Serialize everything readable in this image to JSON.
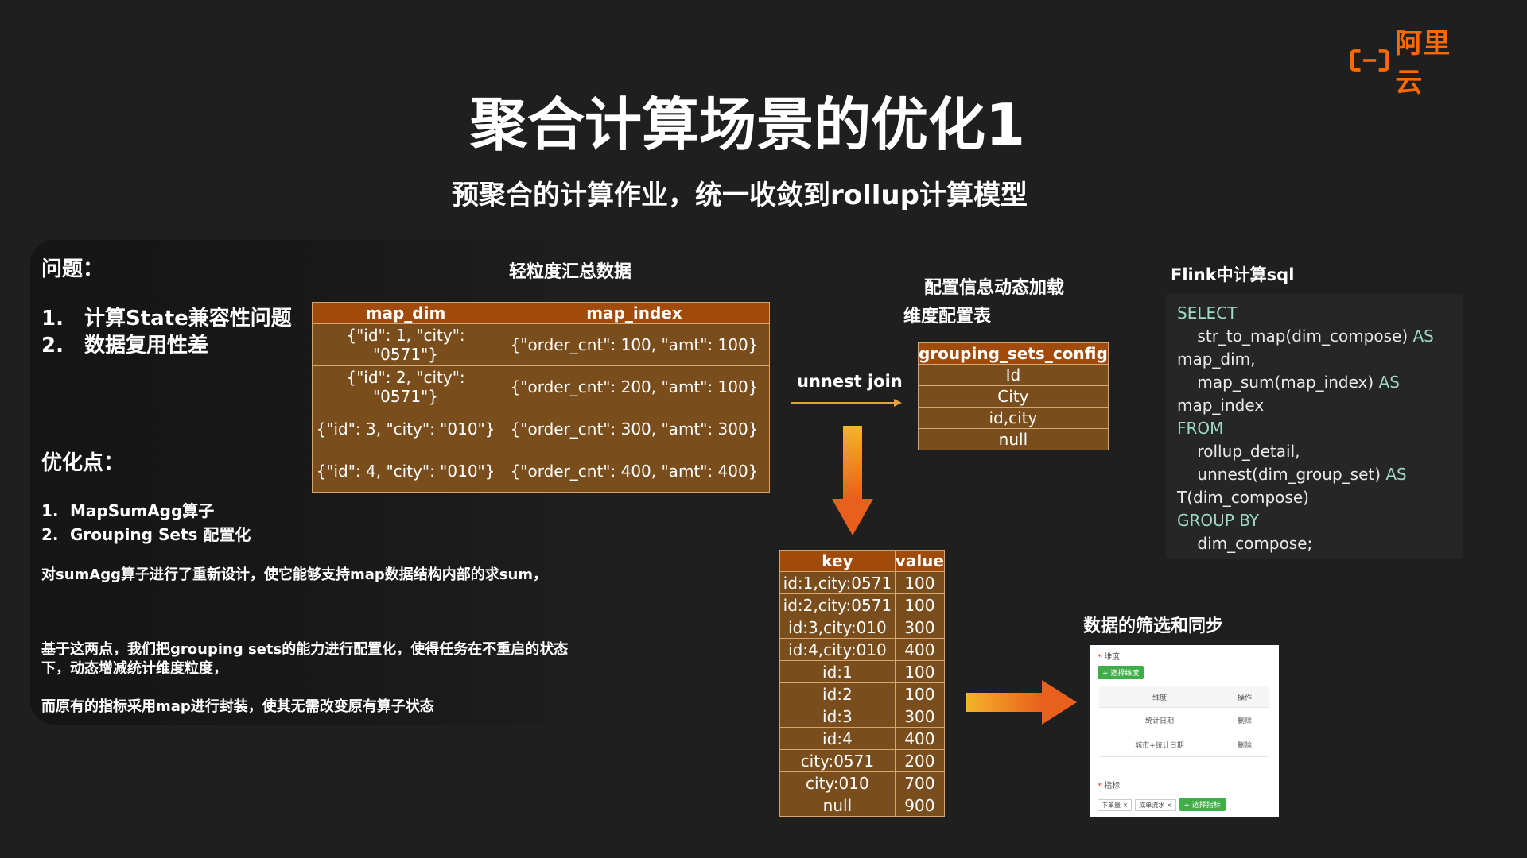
{
  "logo": {
    "text": "阿里云",
    "color": "#ff6a00"
  },
  "title": "聚合计算场景的优化1",
  "subtitle": "预聚合的计算作业，统一收敛到rollup计算模型",
  "left": {
    "problem_heading": "问题：",
    "problems": [
      {
        "num": "1.",
        "text": "计算State兼容性问题"
      },
      {
        "num": "2.",
        "text": "数据复用性差"
      }
    ],
    "opt_heading": "优化点：",
    "opts": [
      {
        "num": "1.",
        "text": "MapSumAgg算子"
      },
      {
        "num": "2.",
        "text": "Grouping Sets 配置化"
      }
    ],
    "para1": "对sumAgg算子进行了重新设计，使它能够支持map数据结构内部的求sum，",
    "para2": "基于这两点，我们把grouping sets的能力进行配置化，使得任务在不重启的状态下，动态增减统计维度粒度，",
    "para3": "而原有的指标采用map进行封装，使其无需改变原有算子状态"
  },
  "main_table": {
    "title": "轻粒度汇总数据",
    "headers": [
      "map_dim",
      "map_index"
    ],
    "rows": [
      [
        "{\"id\": 1, \"city\": \"0571\"}",
        "{\"order_cnt\": 100, \"amt\": 100}"
      ],
      [
        "{\"id\": 2, \"city\": \"0571\"}",
        "{\"order_cnt\": 200, \"amt\": 100}"
      ],
      [
        "{\"id\": 3, \"city\": \"010\"}",
        "{\"order_cnt\": 300, \"amt\": 300}"
      ],
      [
        "{\"id\": 4, \"city\": \"010\"}",
        "{\"order_cnt\": 400, \"amt\": 400}"
      ]
    ]
  },
  "unnest_label": "unnest join",
  "config": {
    "title_line1": "配置信息动态加载",
    "title_line2": "维度配置表",
    "header": "grouping_sets_config",
    "rows": [
      "Id",
      "City",
      "id,city",
      "null"
    ]
  },
  "kv_table": {
    "headers": [
      "key",
      "value"
    ],
    "rows": [
      [
        "id:1,city:0571",
        "100"
      ],
      [
        "id:2,city:0571",
        "100"
      ],
      [
        "id:3,city:010",
        "300"
      ],
      [
        "id:4,city:010",
        "400"
      ],
      [
        "id:1",
        "100"
      ],
      [
        "id:2",
        "100"
      ],
      [
        "id:3",
        "300"
      ],
      [
        "id:4",
        "400"
      ],
      [
        "city:0571",
        "200"
      ],
      [
        "city:010",
        "700"
      ],
      [
        "null",
        "900"
      ]
    ]
  },
  "sql": {
    "title": "Flink中计算sql",
    "l1": "SELECT",
    "l2": "    str_to_map(dim_compose)",
    "l2kw": " AS",
    "l3": "map_dim,",
    "l4": "    map_sum(map_index)",
    "l4kw": " AS",
    "l5": "map_index",
    "l6": "FROM",
    "l7": "    rollup_detail,",
    "l8": "    unnest(dim_group_set)",
    "l8kw": " AS",
    "l9": "T(dim_compose)",
    "l10": "GROUP BY",
    "l11": "    dim_compose;"
  },
  "filter": {
    "title": "数据的筛选和同步",
    "dim_label": "维度",
    "add_dim": "+ 选择维度",
    "col_dim": "维度",
    "col_op": "操作",
    "row1": "统计日期",
    "row2": "城市+统计日期",
    "del": "删除",
    "metric_label": "指标",
    "tag1": "下单量 ×",
    "tag2": "成单流水 ×",
    "add_metric": "+ 选择指标"
  }
}
